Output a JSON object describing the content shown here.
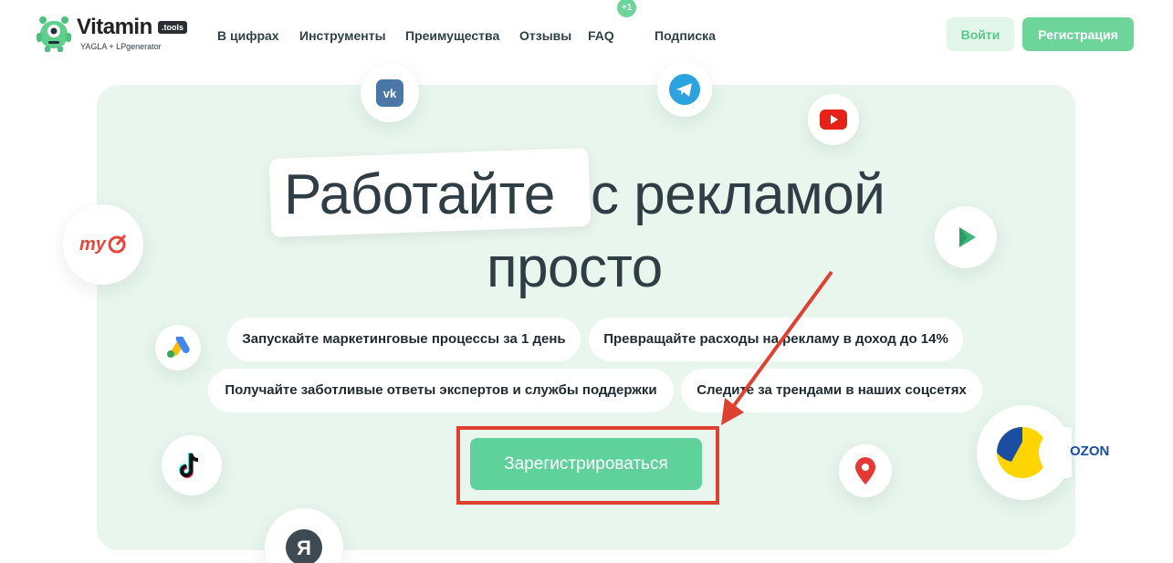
{
  "header": {
    "logo": {
      "name": "Vitamin",
      "badge": ".tools",
      "subtitle": "YAGLA + LPgenerator"
    },
    "nav": [
      {
        "label": "В цифрах"
      },
      {
        "label": "Инструменты"
      },
      {
        "label": "Преимущества"
      },
      {
        "label": "Отзывы"
      },
      {
        "label": "FAQ",
        "badge": "+1"
      },
      {
        "label": "Подписка"
      }
    ],
    "login_label": "Войти",
    "register_label": "Регистрация"
  },
  "hero": {
    "headline_highlight": "Работайте",
    "headline_rest": "с рекламой",
    "headline_line2": "просто",
    "features": [
      "Запускайте маркетинговые процессы за 1 день",
      "Превращайте расходы на рекламу в доход до 14%",
      "Получайте заботливые ответы экспертов и службы поддержки",
      "Следите за трендами в наших соцсетях"
    ],
    "cta_label": "Зарегистрироваться",
    "social_icons": [
      "vk-icon",
      "telegram-icon",
      "youtube-icon",
      "mytarget-icon",
      "play-icon",
      "google-ads-icon",
      "tiktok-icon",
      "yandex-icon",
      "maps-pin-icon",
      "ozon-icon"
    ],
    "social_text": {
      "mytarget": "my",
      "yandex": "Я",
      "ozon": "OZON"
    }
  },
  "colors": {
    "accent": "#6dd49a",
    "hero_bg": "#e8f6ee",
    "annotation": "#e0402f"
  }
}
